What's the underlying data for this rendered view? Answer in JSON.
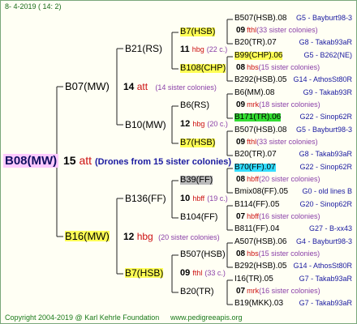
{
  "header": {
    "date": "8-  4-2019 ( 14:  2)"
  },
  "root": {
    "name": "B08(MW)",
    "count": "15",
    "code": "att",
    "note": "(Drones from 15 sister colonies)"
  },
  "gen1": [
    {
      "name": "B07(MW)",
      "count": "14",
      "code": "att",
      "note": "(14 sister colonies)"
    },
    {
      "name": "B16(MW)",
      "count": "12",
      "code": "hbg",
      "note": "(20 sister colonies)"
    }
  ],
  "gen2": [
    {
      "name": "B21(RS)",
      "count": "11",
      "code": "hbg",
      "note": "(22 c.)"
    },
    {
      "name": "B10(MW)",
      "count": "12",
      "code": "hbg",
      "note": "(20 c.)"
    },
    {
      "name": "B136(FF)",
      "count": "10",
      "code": "hbff",
      "note": "(19 c.)"
    },
    {
      "name": "B7(HSB)",
      "count": "09",
      "code": "fthl",
      "note": "(33 c.)"
    }
  ],
  "gen3": [
    "B7(HSB)",
    "B108(CHP)",
    "B6(RS)",
    "B7(HSB)",
    "B39(FF)",
    "B104(FF)",
    "B507(HSB)",
    "B20(TR)"
  ],
  "gen4": [
    {
      "name": "B507(HSB).08",
      "right": "G5 - Bayburt98-3"
    },
    {
      "cnt": "09",
      "code": "fthl",
      "note": "(33 sister colonies)"
    },
    {
      "name": "B20(TR).07",
      "right": "G8 - Takab93aR"
    },
    {
      "name": "B99(CHP).06",
      "right": "G5 - B262(NE)"
    },
    {
      "cnt": "08",
      "code": "hbs",
      "note": "(15 sister colonies)"
    },
    {
      "name": "B292(HSB).05",
      "right": "G14 - AthosSt80R"
    },
    {
      "name": "B6(MM).08",
      "right": "G9 - Takab93R"
    },
    {
      "cnt": "09",
      "code": "mrk",
      "note": "(18 sister colonies)"
    },
    {
      "name": "B171(TR).06",
      "right": "G22 - Sinop62R"
    },
    {
      "name": "B507(HSB).08",
      "right": "G5 - Bayburt98-3"
    },
    {
      "cnt": "09",
      "code": "fthl",
      "note": "(33 sister colonies)"
    },
    {
      "name": "B20(TR).07",
      "right": "G8 - Takab93aR"
    },
    {
      "name": "B70(FF).07",
      "right": "G22 - Sinop62R"
    },
    {
      "cnt": "08",
      "code": "hbff",
      "note": "(20 sister colonies)"
    },
    {
      "name": "Bmix08(FF).05",
      "right": "G0 - old lines B"
    },
    {
      "name": "B114(FF).05",
      "right": "G20 - Sinop62R"
    },
    {
      "cnt": "07",
      "code": "hbff",
      "note": "(16 sister colonies)"
    },
    {
      "name": "B811(FF).04",
      "right": "G27 - B-xx43"
    },
    {
      "name": "A507(HSB).06",
      "right": "G4 - Bayburt98-3"
    },
    {
      "cnt": "08",
      "code": "hbs",
      "note": "(15 sister colonies)"
    },
    {
      "name": "B292(HSB).05",
      "right": "G14 - AthosSt80R"
    },
    {
      "name": "I16(TR).05",
      "right": "G7 - Takab93aR"
    },
    {
      "cnt": "07",
      "code": "mrk",
      "note": "(16 sister colonies)"
    },
    {
      "name": "B19(MKK).03",
      "right": "G7 - Takab93aR"
    }
  ],
  "footer": {
    "copyright": "Copyright 2004-2019 @ Karl Kehrle Foundation",
    "site": "www.pedigreeapis.org"
  },
  "colors": {
    "background": "#fffff4",
    "root_highlight": "#ffcaff",
    "yellow_highlight": "#ffff55",
    "green_highlight": "#33dd33",
    "blue_highlight": "#33ddff",
    "gray_highlight": "#bbbbbb"
  }
}
